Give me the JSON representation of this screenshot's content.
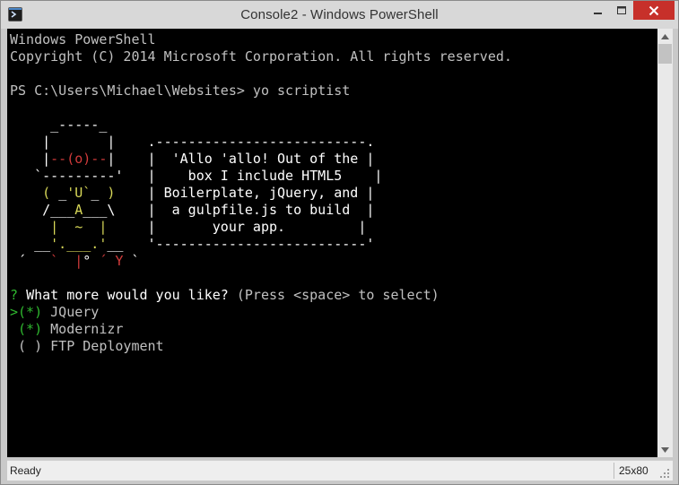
{
  "window": {
    "title": "Console2 - Windows PowerShell"
  },
  "console": {
    "lines": [
      [
        {
          "t": "Windows PowerShell",
          "c": "gray"
        }
      ],
      [
        {
          "t": "Copyright (C) 2014 Microsoft Corporation. All rights reserved.",
          "c": "gray"
        }
      ],
      [
        {
          "t": "",
          "c": "gray"
        }
      ],
      [
        {
          "t": "PS C:\\Users\\Michael\\Websites> yo scriptist",
          "c": "gray"
        }
      ],
      [
        {
          "t": "",
          "c": "gray"
        }
      ],
      [
        {
          "t": "     _-----_",
          "c": "white"
        }
      ],
      [
        {
          "t": "    |       |    ",
          "c": "white"
        },
        {
          "t": ".--------------------------.",
          "c": "white"
        }
      ],
      [
        {
          "t": "    |",
          "c": "white"
        },
        {
          "t": "--(o)--",
          "c": "red"
        },
        {
          "t": "|    |  'Allo 'allo! Out of the |",
          "c": "white"
        }
      ],
      [
        {
          "t": "   `---------'   |    box I include HTML5    |",
          "c": "white"
        }
      ],
      [
        {
          "t": "    ",
          "c": "white"
        },
        {
          "t": "( ",
          "c": "yellow"
        },
        {
          "t": "_",
          "c": "white"
        },
        {
          "t": "'U`",
          "c": "yellow"
        },
        {
          "t": "_ ",
          "c": "white"
        },
        {
          "t": ")",
          "c": "yellow"
        },
        {
          "t": "    | Boilerplate, jQuery, and |",
          "c": "white"
        }
      ],
      [
        {
          "t": "    /___",
          "c": "white"
        },
        {
          "t": "A",
          "c": "yellow"
        },
        {
          "t": "___\\    |  a gulpfile.js to build  |",
          "c": "white"
        }
      ],
      [
        {
          "t": "     ",
          "c": "white"
        },
        {
          "t": "|  ~  |",
          "c": "yellow"
        },
        {
          "t": "     |       your app.         |",
          "c": "white"
        }
      ],
      [
        {
          "t": "   __",
          "c": "white"
        },
        {
          "t": "'.___.'",
          "c": "yellow"
        },
        {
          "t": "__   '--------------------------'",
          "c": "white"
        }
      ],
      [
        {
          "t": " ´   ",
          "c": "white"
        },
        {
          "t": "`  |",
          "c": "red"
        },
        {
          "t": "° ",
          "c": "white"
        },
        {
          "t": "´ Y",
          "c": "red"
        },
        {
          "t": " `",
          "c": "white"
        }
      ],
      [
        {
          "t": "",
          "c": "gray"
        }
      ],
      [
        {
          "t": "? ",
          "c": "green"
        },
        {
          "t": "What more would you like?",
          "c": "white"
        },
        {
          "t": " (Press <space> to select)",
          "c": "gray"
        }
      ],
      [
        {
          "t": ">",
          "c": "green"
        },
        {
          "t": "(*)",
          "c": "green"
        },
        {
          "t": " JQuery",
          "c": "gray"
        }
      ],
      [
        {
          "t": " ",
          "c": "gray"
        },
        {
          "t": "(*)",
          "c": "green"
        },
        {
          "t": " Modernizr",
          "c": "gray"
        }
      ],
      [
        {
          "t": " ( ) FTP Deployment",
          "c": "gray"
        }
      ]
    ]
  },
  "statusbar": {
    "status": "Ready",
    "size": "25x80"
  },
  "colors": {
    "close_button": "#c7302a",
    "console_bg": "#000000",
    "prompt_green": "#2fb82f",
    "yeoman_yellow": "#d8d858",
    "yeoman_red": "#d23b3b"
  }
}
